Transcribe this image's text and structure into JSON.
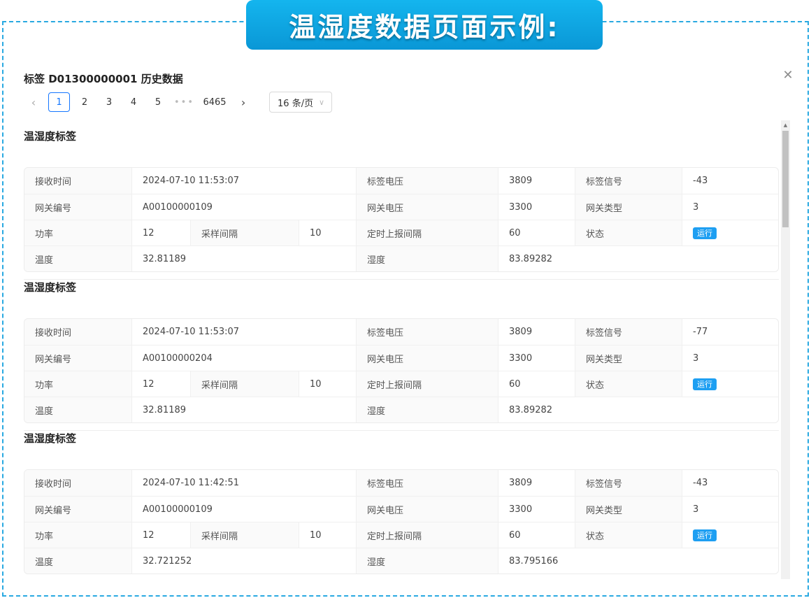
{
  "banner": {
    "title": "温湿度数据页面示例:"
  },
  "modal": {
    "title": "标签 D01300000001 历史数据",
    "close_glyph": "✕"
  },
  "pagination": {
    "prev_glyph": "‹",
    "next_glyph": "›",
    "pages": [
      "1",
      "2",
      "3",
      "4",
      "5"
    ],
    "ellipsis": "•••",
    "last_page": "6465",
    "current": "1",
    "page_size": "16 条/页",
    "chevron": "∨"
  },
  "labels": {
    "recv_time": "接收时间",
    "tag_voltage": "标签电压",
    "tag_signal": "标签信号",
    "gateway_id": "网关编号",
    "gateway_voltage": "网关电压",
    "gateway_type": "网关类型",
    "power": "功率",
    "sample_interval": "采样间隔",
    "report_interval": "定时上报间隔",
    "status": "状态",
    "temperature": "温度",
    "humidity": "湿度"
  },
  "records": [
    {
      "title": "温湿度标签",
      "recv_time": "2024-07-10 11:53:07",
      "tag_voltage": "3809",
      "tag_signal": "-43",
      "gateway_id": "A00100000109",
      "gateway_voltage": "3300",
      "gateway_type": "3",
      "power": "12",
      "sample_interval": "10",
      "report_interval": "60",
      "status": "运行",
      "temperature": "32.81189",
      "humidity": "83.89282"
    },
    {
      "title": "温湿度标签",
      "recv_time": "2024-07-10 11:53:07",
      "tag_voltage": "3809",
      "tag_signal": "-77",
      "gateway_id": "A00100000204",
      "gateway_voltage": "3300",
      "gateway_type": "3",
      "power": "12",
      "sample_interval": "10",
      "report_interval": "60",
      "status": "运行",
      "temperature": "32.81189",
      "humidity": "83.89282"
    },
    {
      "title": "温湿度标签",
      "recv_time": "2024-07-10 11:42:51",
      "tag_voltage": "3809",
      "tag_signal": "-43",
      "gateway_id": "A00100000109",
      "gateway_voltage": "3300",
      "gateway_type": "3",
      "power": "12",
      "sample_interval": "10",
      "report_interval": "60",
      "status": "运行",
      "temperature": "32.721252",
      "humidity": "83.795166"
    }
  ],
  "colors": {
    "accent": "#1677ff",
    "banner": "#0a9fdc",
    "badge": "#1e9ff2",
    "frame_border": "#29a9e1"
  }
}
